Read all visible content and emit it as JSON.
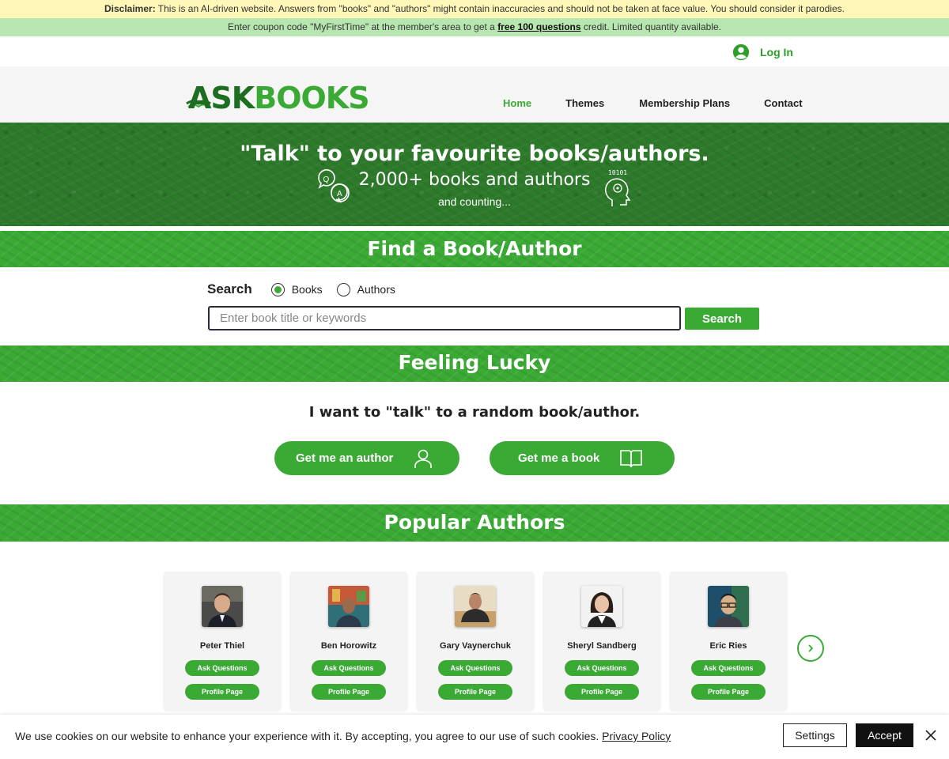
{
  "banner": {
    "disclaimer_bold": "Disclaimer:",
    "disclaimer_text": " This is an AI-driven website. Answers from \"books\" and \"authors\" might contain inaccuracies and should not be taken at face value. You should consider it parodies.",
    "coupon_text_before": "Enter coupon code \"MyFirstTime\" at the member's area to get a ",
    "coupon_link": "free 100 questions",
    "coupon_text_after": " credit. Limited quantity available."
  },
  "login": {
    "label": "Log In",
    "icon": "user-circle-icon"
  },
  "logo": {
    "part1": "ASK",
    "part2": "BOOKS"
  },
  "nav": {
    "items": [
      {
        "label": "Home",
        "active": true
      },
      {
        "label": "Themes",
        "active": false
      },
      {
        "label": "Membership Plans",
        "active": false
      },
      {
        "label": "Contact",
        "active": false
      }
    ]
  },
  "hero": {
    "title": "\"Talk\" to your favourite books/authors.",
    "subtitle": "2,000+ books and authors",
    "small": "and counting...",
    "binary_label": "10101"
  },
  "find": {
    "heading": "Find a Book/Author",
    "search_label": "Search",
    "radio_books": "Books",
    "radio_authors": "Authors",
    "selected": "Books",
    "placeholder": "Enter book title or keywords",
    "button": "Search"
  },
  "lucky": {
    "heading": "Feeling Lucky",
    "text": "I want to \"talk\" to a random book/author.",
    "author_button": "Get me an author",
    "book_button": "Get me a book"
  },
  "popular": {
    "heading": "Popular Authors",
    "ask_label": "Ask Questions",
    "profile_label": "Profile Page",
    "authors": [
      {
        "name": "Peter Thiel"
      },
      {
        "name": "Ben Horowitz"
      },
      {
        "name": "Gary Vaynerchuk"
      },
      {
        "name": "Sheryl Sandberg"
      },
      {
        "name": "Eric Ries"
      }
    ]
  },
  "cookie": {
    "text": "We use cookies on our website to enhance your experience with it. By accepting, you agree to our use of such cookies. ",
    "policy_link": "Privacy Policy",
    "settings": "Settings",
    "accept": "Accept"
  },
  "colors": {
    "brand_green": "#3aaa35",
    "dark_green": "#2d7a2b",
    "disclaimer_bg": "#fff7b8",
    "coupon_bg": "#b8e6b0"
  }
}
